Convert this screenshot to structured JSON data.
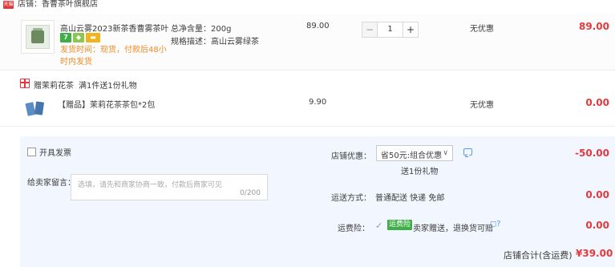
{
  "store": {
    "tag": "天猫",
    "name": "店铺：香曹茶叶旗舰店"
  },
  "product": {
    "title": "高山云雾2023新茶香曹雾茶叶...",
    "badge_seven": "7",
    "ship_note": "发货时间：现货，付款后48小时内发货",
    "spec_weight": "总净含量：200g",
    "spec_desc": "规格描述：高山云雾绿茶",
    "unit_price": "89.00",
    "quantity": "1",
    "qty_minus": "−",
    "qty_plus": "+",
    "discount": "无优惠",
    "subtotal": "89.00"
  },
  "gift": {
    "title": "赠茉莉花茶",
    "desc": "满1件送1份礼物",
    "name": "【赠品】茉莉花茶茶包*2包",
    "price": "9.90",
    "discount": "无优惠",
    "subtotal": "0.00"
  },
  "options": {
    "invoice_label": "开具发票",
    "message_label": "给卖家留言：",
    "message_placeholder": "选填，请先和商家协商一致，付款后商家可见",
    "message_count": "0/200",
    "shop_discount_label": "店铺优惠：",
    "shop_discount_value": "省50元:组合优惠",
    "shop_discount_chevron": "∨",
    "gift_note": "送1份礼物",
    "shop_discount_amount": "-50.00",
    "shipping_label": "运送方式：",
    "shipping_value": "普通配送 快递 免邮",
    "shipping_amount": "0.00",
    "insurance_label": "运费险：",
    "insurance_check": "✓",
    "insurance_badge": "运费险",
    "insurance_text": "卖家赠送，退换货可赔",
    "insurance_icons": "◻?",
    "insurance_amount": "0.00"
  },
  "total": {
    "label": "店铺合计(含运费)",
    "amount": "¥39.00"
  }
}
